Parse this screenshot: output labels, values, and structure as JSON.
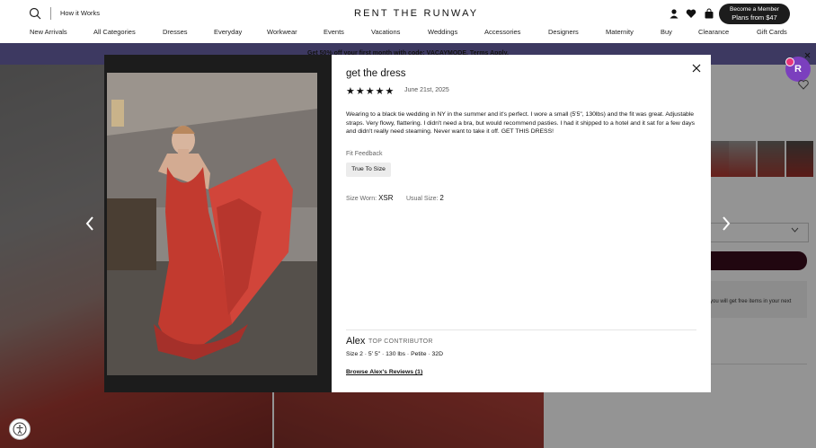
{
  "header": {
    "how_it_works": "How it Works",
    "logo": "RENT THE RUNWAY",
    "member_line1": "Become a Member",
    "member_line2": "Plans from $47",
    "icons": [
      "search-icon",
      "user-icon",
      "heart-icon",
      "bag-icon"
    ]
  },
  "nav": [
    "New Arrivals",
    "All Categories",
    "Dresses",
    "Everyday",
    "Workwear",
    "Events",
    "Vacations",
    "Weddings",
    "Accessories",
    "Designers",
    "Maternity",
    "Buy",
    "Clearance",
    "Gift Cards"
  ],
  "promo": "Get 50% off your first month with code: VACAYMODE. Terms Apply.",
  "review": {
    "title": "get the dress",
    "rating": 5,
    "stars": "★★★★★",
    "date": "June 21st, 2025",
    "body": "Wearing to a black tie wedding in NY in the summer and it's perfect. I wore a small (5'5\", 130lbs) and the fit was great. Adjustable straps. Very flowy, flattering. I didn't need a bra, but would recommend pasties. I had it shipped to a hotel and it sat for a few days and didn't really need steaming. Never want to take it off. GET THIS DRESS!",
    "fit_feedback_label": "Fit Feedback",
    "fit_feedback_value": "True To Size",
    "size_worn_label": "Size Worn:",
    "size_worn_value": "XSR",
    "usual_size_label": "Usual Size:",
    "usual_size_value": "2"
  },
  "reviewer": {
    "name": "Alex",
    "badge": "TOP CONTRIBUTOR",
    "stats": "Size 2 · 5' 5\" · 130 lbs · Petite · 32D",
    "browse_link": "Browse Alex's Reviews (1)"
  },
  "page_behind": {
    "info_text": "you will get free items in your next"
  },
  "widget_badge": "R",
  "colors": {
    "promo_bg": "#6a63a8",
    "cta_bg": "#3a0d1c",
    "member_bg": "#1c1c1c",
    "widget": "#7b3fbe"
  }
}
